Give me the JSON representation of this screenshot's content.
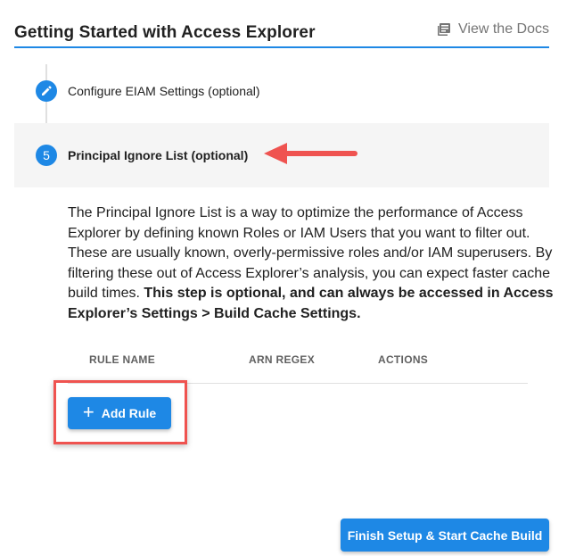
{
  "header": {
    "title": "Getting Started with Access Explorer",
    "docs_label": "View the Docs",
    "docs_icon": "book-icon"
  },
  "steps": [
    {
      "marker": "pencil-icon",
      "label": "Configure EIAM Settings (optional)"
    },
    {
      "number": "5",
      "label": "Principal Ignore List (optional)"
    }
  ],
  "description": {
    "text": "The Principal Ignore List is a way to optimize the performance of Access Explorer by defining known Roles or IAM Users that you want to filter out. These are usually known, overly-permissive roles and/or IAM superusers. By filtering these out of Access Explorer’s analysis, you can expect faster cache build times. ",
    "bold": "This step is optional, and can always be accessed in Access Explorer’s Settings > Build Cache Settings."
  },
  "table": {
    "columns": [
      "RULE NAME",
      "ARN REGEX",
      "ACTIONS"
    ]
  },
  "buttons": {
    "add_rule": "Add Rule",
    "finish": "Finish Setup & Start Cache Build"
  },
  "colors": {
    "accent": "#1e88e5",
    "annotation": "#ef5350"
  }
}
